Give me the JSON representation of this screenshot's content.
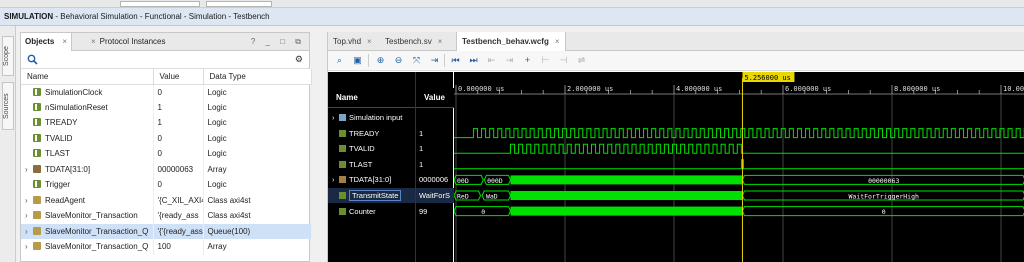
{
  "title_bar": {
    "mode": "SIMULATION",
    "description": " - Behavioral Simulation - Functional - Simulation - Testbench"
  },
  "left_tabs": [
    "Scope",
    "Sources"
  ],
  "objects_panel": {
    "tabs": [
      {
        "label": "Objects",
        "active": true
      },
      {
        "label": "Protocol Instances",
        "active": false
      }
    ],
    "controls": "? _ □ ⧉",
    "columns": [
      "Name",
      "Value",
      "Data Type"
    ],
    "rows": [
      {
        "name": "SimulationClock",
        "value": "0",
        "type": "Logic",
        "icon": "bit",
        "expandable": false
      },
      {
        "name": "nSimulationReset",
        "value": "1",
        "type": "Logic",
        "icon": "bit",
        "expandable": false
      },
      {
        "name": "TREADY",
        "value": "1",
        "type": "Logic",
        "icon": "bit",
        "expandable": false
      },
      {
        "name": "TVALID",
        "value": "0",
        "type": "Logic",
        "icon": "bit",
        "expandable": false
      },
      {
        "name": "TLAST",
        "value": "0",
        "type": "Logic",
        "icon": "bit",
        "expandable": false
      },
      {
        "name": "TDATA[31:0]",
        "value": "00000063",
        "type": "Array",
        "icon": "bus",
        "expandable": true
      },
      {
        "name": "Trigger",
        "value": "0",
        "type": "Logic",
        "icon": "bit",
        "expandable": false
      },
      {
        "name": "ReadAgent",
        "value": "'{C_XIL_AXI4",
        "type": "Class axi4st",
        "icon": "obj",
        "expandable": true
      },
      {
        "name": "SlaveMonitor_Transaction",
        "value": "'{ready_ass",
        "type": "Class axi4st",
        "icon": "obj",
        "expandable": true
      },
      {
        "name": "SlaveMonitor_Transaction_Q",
        "value": "'{'{ready_ass",
        "type": "Queue(100)",
        "icon": "obj",
        "expandable": true,
        "selected": true
      },
      {
        "name": "SlaveMonitor_Transaction_Q",
        "value": "100",
        "type": "Array",
        "icon": "obj",
        "expandable": true
      }
    ]
  },
  "editor_tabs": [
    {
      "label": "Top.vhd",
      "active": false
    },
    {
      "label": "Testbench.sv",
      "active": false
    },
    {
      "label": "Testbench_behav.wcfg",
      "active": true
    }
  ],
  "wave": {
    "name_header": "Name",
    "value_header": "Value",
    "cursor_time": "5.256000 us",
    "time_ticks": [
      "0.000000 us",
      "2.000000 us",
      "4.000000 us",
      "6.000000 us",
      "8.000000 us",
      "10.00000"
    ],
    "signals": [
      {
        "name": "Simulation input",
        "value": "",
        "icon": "grp",
        "expandable": true
      },
      {
        "name": "TREADY",
        "value": "1",
        "icon": "bit",
        "expandable": false
      },
      {
        "name": "TVALID",
        "value": "1",
        "icon": "bit",
        "expandable": false
      },
      {
        "name": "TLAST",
        "value": "1",
        "icon": "bit",
        "expandable": false
      },
      {
        "name": "TDATA[31:0]",
        "value": "0000006",
        "icon": "bus",
        "expandable": true
      },
      {
        "name": "TransmitState",
        "value": "WaitForS",
        "icon": "bit",
        "expandable": false,
        "selected": true
      },
      {
        "name": "Counter",
        "value": "99",
        "icon": "bit",
        "expandable": false
      }
    ],
    "bus_labels": {
      "tdata_a": "00D",
      "tdata_b": "000D",
      "tdata_end": "00000063",
      "state_a": "ReD",
      "state_b": "WaD",
      "state_end": "WaitForTriggerHigh",
      "counter_a": "0",
      "counter_end": "0"
    },
    "colors": {
      "signal": "#00e000",
      "cursor": "#e8d800",
      "background": "#000000",
      "grid": "#555555"
    }
  }
}
